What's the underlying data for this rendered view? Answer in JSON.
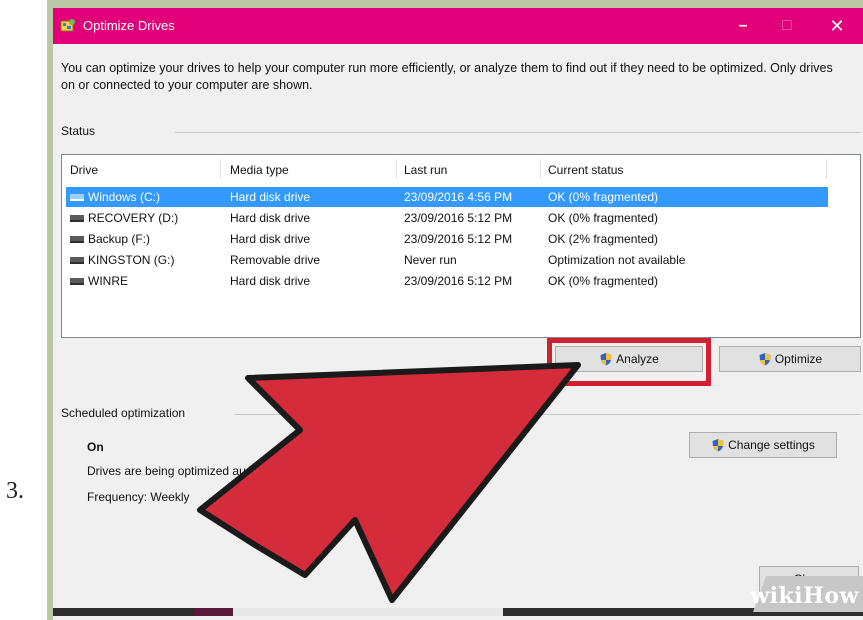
{
  "step_number": "3.",
  "window": {
    "title": "Optimize Drives",
    "controls": {
      "minimize": "–",
      "maximize": "□",
      "close": "✕"
    },
    "intro_text": "You can optimize your drives to help your computer run more efficiently, or analyze them to find out if they need to be optimized. Only drives on or connected to your computer are shown."
  },
  "status": {
    "label": "Status",
    "columns": [
      "Drive",
      "Media type",
      "Last run",
      "Current status"
    ],
    "drives": [
      {
        "drive": "Windows (C:)",
        "media": "Hard disk drive",
        "last_run": "23/09/2016 4:56 PM",
        "status": "OK (0% fragmented)",
        "selected": true
      },
      {
        "drive": "RECOVERY (D:)",
        "media": "Hard disk drive",
        "last_run": "23/09/2016 5:12 PM",
        "status": "OK (0% fragmented)",
        "selected": false
      },
      {
        "drive": "Backup (F:)",
        "media": "Hard disk drive",
        "last_run": "23/09/2016 5:12 PM",
        "status": "OK (2% fragmented)",
        "selected": false
      },
      {
        "drive": "KINGSTON (G:)",
        "media": "Removable drive",
        "last_run": "Never run",
        "status": "Optimization not available",
        "selected": false
      },
      {
        "drive": "WINRE",
        "media": "Hard disk drive",
        "last_run": "23/09/2016 5:12 PM",
        "status": "OK (0% fragmented)",
        "selected": false
      }
    ],
    "analyze_label": "Analyze",
    "optimize_label": "Optimize"
  },
  "scheduled": {
    "label": "Scheduled optimization",
    "state": "On",
    "description": "Drives are being optimized au",
    "frequency": "Frequency: Weekly",
    "change_settings_label": "Change settings"
  },
  "close_label": "Close",
  "watermark": "wikiHow",
  "colors": {
    "titlebar": "#e2007a",
    "selection": "#3399ff",
    "arrow": "#d42c3a",
    "highlight": "#d01f2f"
  }
}
